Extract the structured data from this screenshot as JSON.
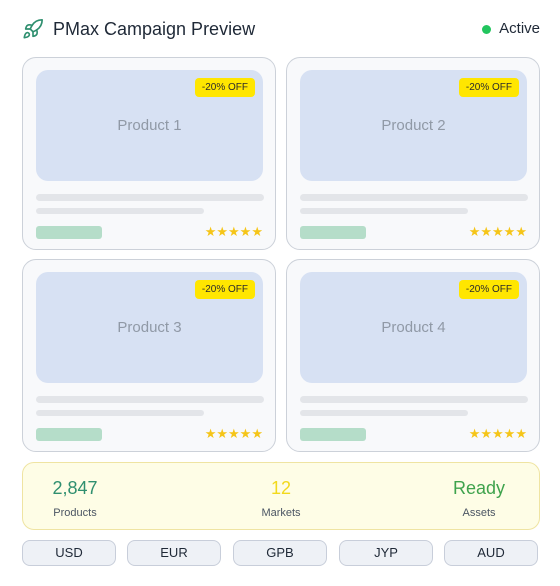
{
  "header": {
    "title": "PMax Campaign Preview",
    "logo_icon": "rocket-icon",
    "status": {
      "label": "Active",
      "color": "#22c55e"
    }
  },
  "products": [
    {
      "name": "Product 1",
      "badge": "-20% OFF",
      "stars": "★★★★★",
      "rating": 5
    },
    {
      "name": "Product 2",
      "badge": "-20% OFF",
      "stars": "★★★★★",
      "rating": 5
    },
    {
      "name": "Product 3",
      "badge": "-20% OFF",
      "stars": "★★★★★",
      "rating": 5
    },
    {
      "name": "Product 4",
      "badge": "-20% OFF",
      "stars": "★★★★★",
      "rating": 5
    }
  ],
  "stats": [
    {
      "value": "2,847",
      "label": "Products",
      "color": "#2f8f6f"
    },
    {
      "value": "12",
      "label": "Markets",
      "color": "#f2d91d"
    },
    {
      "value": "Ready",
      "label": "Assets",
      "color": "#3fa34d"
    }
  ],
  "currencies": [
    "USD",
    "EUR",
    "GPB",
    "JYP",
    "AUD"
  ],
  "colors": {
    "accent": "#2f8f6f",
    "badge": "#ffe600",
    "star": "#f5c518"
  }
}
